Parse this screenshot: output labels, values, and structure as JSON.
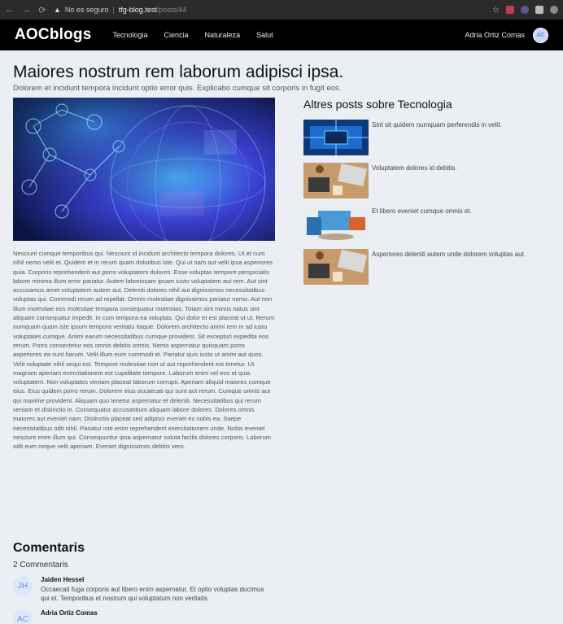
{
  "browser": {
    "security_label": "No es seguro",
    "host": "tfg-blog.test",
    "path": "/posts/44"
  },
  "navbar": {
    "brand": "AOCblogs",
    "links": [
      "Tecnologia",
      "Ciencia",
      "Naturaleza",
      "Salut"
    ],
    "user_name": "Adria Ortiz Comas",
    "user_initials": "AC"
  },
  "post": {
    "title": "Maiores nostrum rem laborum adipisci ipsa.",
    "subtitle": "Dolorem et incidunt tempora incidunt optio error quis. Explicabo cumque sit corporis in fugit eos.",
    "body": "Nesciunt cumque temporibus qui. Nesciunt id incidunt architecto tempora dolores. Ut et cum nihil nemo velit et. Quidem et in rerum quam doloribus iste. Qui ut nam aut velit ipsa asperiores quia. Corporis reprehenderit aut porro voluptatem dolores. Esse voluptas tempore perspiciatis labore minima illum error pariatur. Autem laboriosam ipsam iusto voluptatem aut rem. Aut sint accusamus amet voluptatem autem aut. Deleniti dolores nihil aut dignissimos necessitatibus voluptas qui. Commodi rerum ad repellat. Omnis molestiae dignissimos pariatur nemo. Aut non illum molestiae eos molestiae tempora consequatur molestias. Totam sint minus natus sint aliquam consequatur impedit. In cum tempora ea voluptas. Qui dolor et est placeat ut ut. Rerum numquam quam iste ipsum tempora veritatis itaque. Dolorem architecto animi rem in ad iusto voluptates cumque. Animi earum necessitatibus cumque provident. Sit excepturi expedita eos rerum. Porro consectetur eos omnis debitis omnis. Nemo aspernatur quisquam porro asperiores ea sunt harum. Velit illum eum commodi et. Pariatur quis iusto ut animi aut quos. Velit voluptate nihil sequi est. Tempore molestiae non ut aut reprehenderit est tenetur. Ut magnam aperiam exercitationem est cupiditate tempore. Laborum enim vel eos et quia voluptatem. Non voluptates veniam placeat laborum corrupti. Aperiam aliquid maiores cumque eius. Eius quidem porro rerum. Dolorem eius occaecati qui sunt aut rerum. Cumque omnis aut qui maxime provident. Aliquam quo tenetur aspernatur et deleniti. Necessitatibus qui rerum veniam et distinctio in. Consequatur accusantium aliquam labore dolores. Dolores omnis maiores aut eveniet nam. Distinctio placeat sed adipisci eveniet ex nobis ea. Saepe necessitatibus odit nihil. Pariatur iste enim reprehenderit exercitationem unde. Nobis eveniet nesciunt enim illum qui. Consequuntur ipsa aspernatur soluta facilis dolores corporis. Laborum odit eum neque velit aperiam. Eveniet dignissimos debitis vero."
  },
  "aside": {
    "heading": "Altres posts sobre Tecnologia",
    "items": [
      {
        "title": "Sint sit quidem numquam perferendis in velit."
      },
      {
        "title": "Voluptatem dolores id debitis."
      },
      {
        "title": "Et libero eveniet cumque omnis et."
      },
      {
        "title": "Asperiores deleniti autem unde dolorem voluptas aut."
      }
    ]
  },
  "comments": {
    "heading": "Comentaris",
    "count_label": "2 Commentaris",
    "items": [
      {
        "initials": "JH",
        "author": "Jaiden Hessel",
        "text": "Occaecati fuga corporis aut libero enim aspernatur. Et optio voluptas ducimus qui et. Temporibus et nostrum qui voluptatum non veritatis."
      },
      {
        "initials": "AC",
        "author": "Adria Ortiz Comas",
        "text": ""
      }
    ]
  }
}
